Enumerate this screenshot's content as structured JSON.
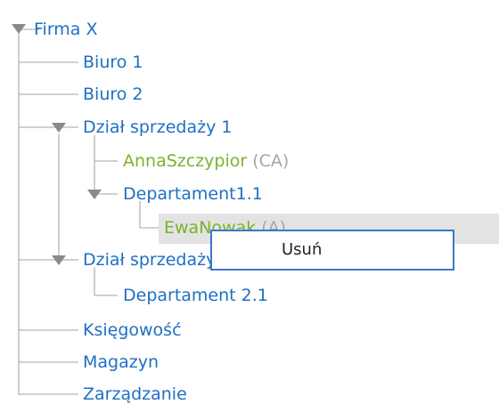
{
  "tree": {
    "root": {
      "label": "Firma X"
    },
    "biuro1": {
      "label": "Biuro 1"
    },
    "biuro2": {
      "label": "Biuro 2"
    },
    "dzial1": {
      "label": "Dział sprzedaży 1"
    },
    "anna": {
      "label": "AnnaSzczypior",
      "role": "(CA)"
    },
    "dep11": {
      "label": "Departament1.1"
    },
    "ewa": {
      "label": "EwaNowak",
      "role": "(A)"
    },
    "dzial2": {
      "label": "Dział sprzedaży 2"
    },
    "dep21": {
      "label": "Departament 2.1"
    },
    "ksiegowosc": {
      "label": "Księgowość"
    },
    "magazyn": {
      "label": "Magazyn"
    },
    "zarzadzanie": {
      "label": "Zarządzanie"
    }
  },
  "context_menu": {
    "delete_label": "Usuń"
  },
  "colors": {
    "unit": "#1f6fc5",
    "person": "#79b32b",
    "role": "#a6a6a6",
    "lines": "#b4b4b4",
    "selection": "#e3e3e3",
    "menu_border": "#3a78c9"
  }
}
